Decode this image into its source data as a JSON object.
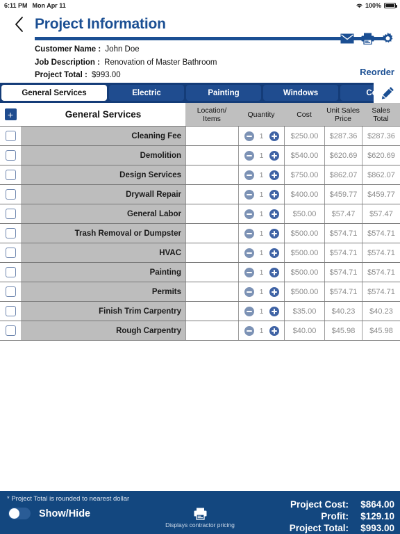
{
  "status_bar": {
    "time": "6:11 PM",
    "date": "Mon Apr 11",
    "wifi_icon": "wifi-icon",
    "battery_percent": "100%",
    "battery_icon": "battery-full-icon"
  },
  "header": {
    "back_icon": "chevron-left-icon",
    "title": "Project Information",
    "icons": [
      {
        "name": "mail-icon"
      },
      {
        "name": "printer-icon"
      },
      {
        "name": "gear-icon"
      }
    ],
    "reorder_label": "Reorder"
  },
  "info": {
    "customer_name_label": "Customer Name :",
    "customer_name_value": "John Doe",
    "job_description_label": "Job Description :",
    "job_description_value": "Renovation of Master Bathroom",
    "project_total_label": "Project Total :",
    "project_total_value": "$993.00"
  },
  "tabs": [
    {
      "label": "General Services",
      "active": true
    },
    {
      "label": "Electric",
      "active": false
    },
    {
      "label": "Painting",
      "active": false
    },
    {
      "label": "Windows",
      "active": false
    },
    {
      "label": "Count",
      "active": false
    }
  ],
  "tab_edit_icon": "pencil-icon",
  "table": {
    "add_button_label": "+",
    "section_title": "General Services",
    "columns": [
      "Location/\nItems",
      "Quantity",
      "Cost",
      "Unit Sales\nPrice",
      "Sales\nTotal"
    ],
    "column_location": "Location/",
    "column_location2": "Items",
    "column_quantity": "Quantity",
    "column_cost": "Cost",
    "column_unit1": "Unit Sales",
    "column_unit2": "Price",
    "column_total1": "Sales",
    "column_total2": "Total",
    "rows": [
      {
        "name": "Cleaning Fee",
        "location": "",
        "quantity": "1",
        "cost": "$250.00",
        "unit_sales_price": "$287.36",
        "sales_total": "$287.36"
      },
      {
        "name": "Demolition",
        "location": "",
        "quantity": "1",
        "cost": "$540.00",
        "unit_sales_price": "$620.69",
        "sales_total": "$620.69"
      },
      {
        "name": "Design Services",
        "location": "",
        "quantity": "1",
        "cost": "$750.00",
        "unit_sales_price": "$862.07",
        "sales_total": "$862.07"
      },
      {
        "name": "Drywall Repair",
        "location": "",
        "quantity": "1",
        "cost": "$400.00",
        "unit_sales_price": "$459.77",
        "sales_total": "$459.77"
      },
      {
        "name": "General Labor",
        "location": "",
        "quantity": "1",
        "cost": "$50.00",
        "unit_sales_price": "$57.47",
        "sales_total": "$57.47"
      },
      {
        "name": "Trash Removal or Dumpster",
        "location": "",
        "quantity": "1",
        "cost": "$500.00",
        "unit_sales_price": "$574.71",
        "sales_total": "$574.71"
      },
      {
        "name": "HVAC",
        "location": "",
        "quantity": "1",
        "cost": "$500.00",
        "unit_sales_price": "$574.71",
        "sales_total": "$574.71"
      },
      {
        "name": "Painting",
        "location": "",
        "quantity": "1",
        "cost": "$500.00",
        "unit_sales_price": "$574.71",
        "sales_total": "$574.71"
      },
      {
        "name": "Permits",
        "location": "",
        "quantity": "1",
        "cost": "$500.00",
        "unit_sales_price": "$574.71",
        "sales_total": "$574.71"
      },
      {
        "name": "Finish Trim Carpentry",
        "location": "",
        "quantity": "1",
        "cost": "$35.00",
        "unit_sales_price": "$40.23",
        "sales_total": "$40.23"
      },
      {
        "name": "Rough Carpentry",
        "location": "",
        "quantity": "1",
        "cost": "$40.00",
        "unit_sales_price": "$45.98",
        "sales_total": "$45.98"
      }
    ]
  },
  "footer": {
    "note": "* Project Total is rounded to nearest dollar",
    "toggle_label": "Show/Hide",
    "toggle_on": false,
    "printer_icon": "printer-icon",
    "printer_caption": "Displays contractor pricing",
    "totals": [
      {
        "label": "Project Cost:",
        "value": "$864.00"
      },
      {
        "label": "Profit:",
        "value": "$129.10"
      },
      {
        "label": "Project Total:",
        "value": "$993.00"
      }
    ]
  },
  "colors": {
    "brand_navy": "#1B4F93",
    "tabbar_navy": "#143C78",
    "footer_navy": "#13477F",
    "row_gray": "#BDBDBD",
    "header_gray": "#BFBFBF",
    "muted_text": "#8c8c8c"
  }
}
